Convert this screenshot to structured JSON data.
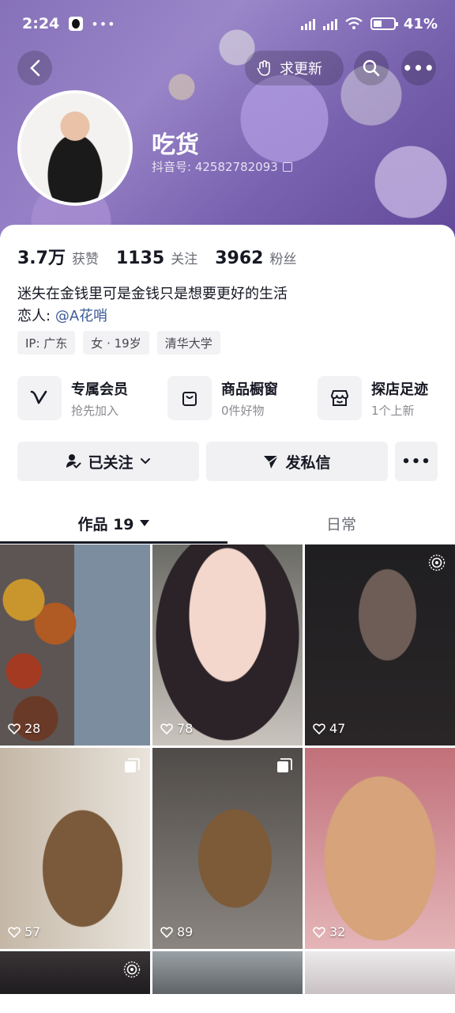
{
  "status_bar": {
    "time": "2:24",
    "battery": "41%"
  },
  "top_nav": {
    "update_label": "求更新"
  },
  "profile": {
    "name": "吃货",
    "douyin_id": "抖音号: 42582782093",
    "stats": [
      {
        "num": "3.7万",
        "label": "获赞"
      },
      {
        "num": "1135",
        "label": "关注"
      },
      {
        "num": "3962",
        "label": "粉丝"
      }
    ],
    "bio_line1": "迷失在金钱里可是金钱只是想要更好的生活",
    "bio_line2_prefix": "恋人:",
    "bio_line2_mention": "@A花哨",
    "tags": [
      "IP: 广东",
      "女 · 19岁",
      "清华大学"
    ]
  },
  "features": [
    {
      "title": "专属会员",
      "sub": "抢先加入",
      "icon": "vip-v-icon"
    },
    {
      "title": "商品橱窗",
      "sub": "0件好物",
      "icon": "shopping-bag-icon"
    },
    {
      "title": "探店足迹",
      "sub": "1个上新",
      "icon": "store-icon"
    }
  ],
  "actions": {
    "follow": "已关注",
    "message": "发私信"
  },
  "tabs": {
    "works": "作品 19",
    "daily": "日常"
  },
  "grid": [
    {
      "likes": "28"
    },
    {
      "likes": "78"
    },
    {
      "likes": "47"
    },
    {
      "likes": "57"
    },
    {
      "likes": "89"
    },
    {
      "likes": "32"
    }
  ]
}
